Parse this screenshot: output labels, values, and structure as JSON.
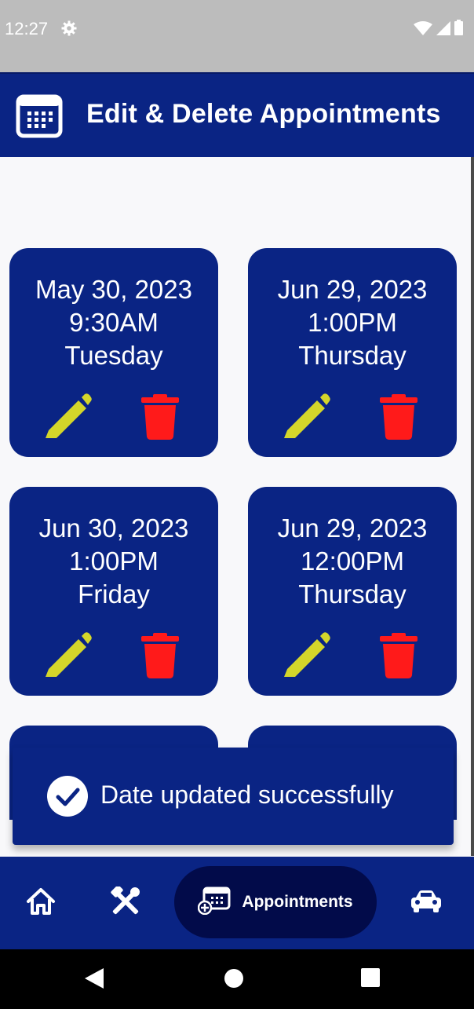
{
  "status_bar": {
    "time": "12:27"
  },
  "app_bar": {
    "title": "Edit & Delete Appointments",
    "icon": "calendar-icon"
  },
  "appointments": [
    {
      "date": "May 30, 2023",
      "time": "9:30AM",
      "day": "Tuesday"
    },
    {
      "date": "Jun 29, 2023",
      "time": "1:00PM",
      "day": "Thursday"
    },
    {
      "date": "Jun 30, 2023",
      "time": "1:00PM",
      "day": "Friday"
    },
    {
      "date": "Jun 29, 2023",
      "time": "12:00PM",
      "day": "Thursday"
    }
  ],
  "snackbar": {
    "message": "Date updated successfully",
    "icon": "check-circle-icon"
  },
  "bottom_nav": {
    "items": [
      {
        "icon": "home-icon"
      },
      {
        "icon": "tools-icon"
      },
      {
        "icon": "appointments-icon",
        "label": "Appointments",
        "active": true
      },
      {
        "icon": "car-icon"
      }
    ]
  },
  "colors": {
    "primary": "#0a2484",
    "active_pill": "#020b4a",
    "edit_icon": "#d4d62a",
    "delete_icon": "#ff1a1a",
    "background": "#f8f8fa"
  }
}
